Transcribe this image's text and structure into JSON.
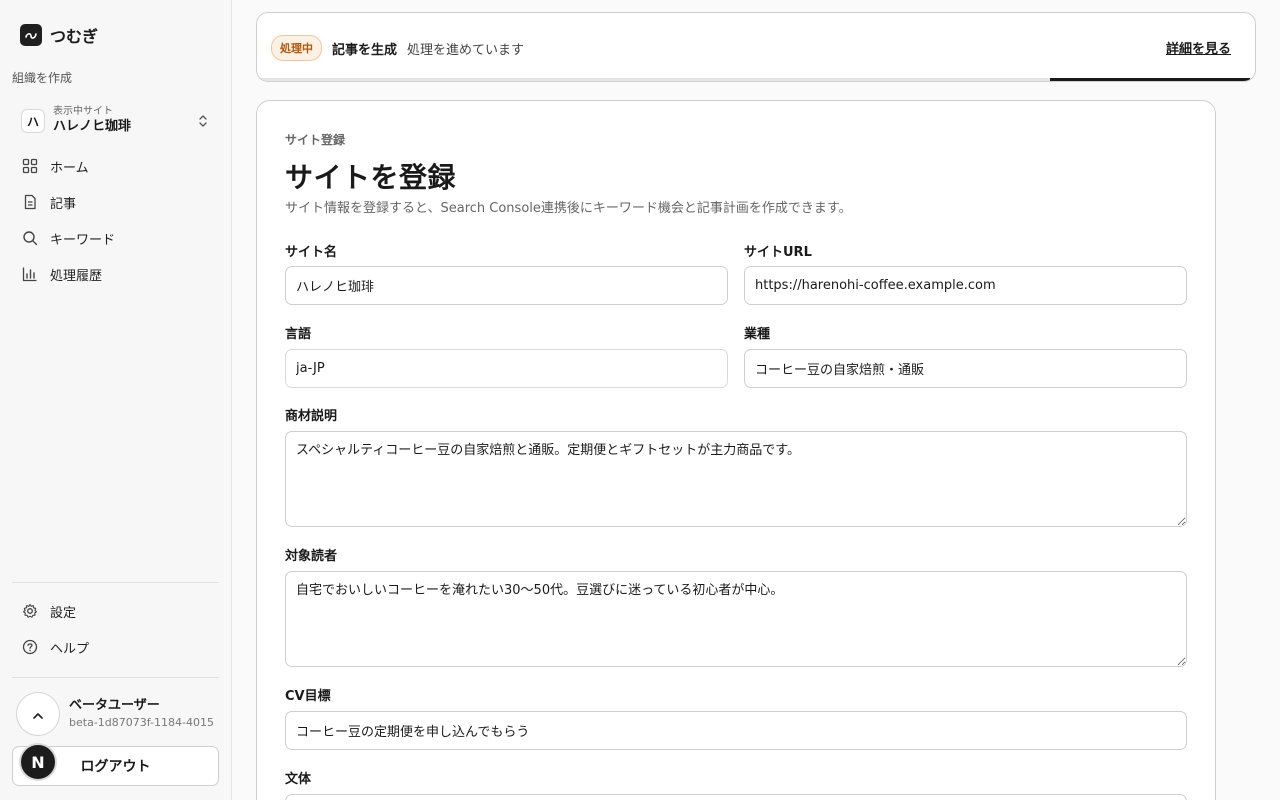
{
  "brand": {
    "name": "つむぎ"
  },
  "sidebar": {
    "org_create": "組織を作成",
    "site_switch": {
      "caption": "表示中サイト",
      "avatar_letter": "ハ",
      "name": "ハレノヒ珈琲"
    },
    "nav": [
      {
        "label": "ホーム",
        "icon": "home-grid-icon"
      },
      {
        "label": "記事",
        "icon": "document-icon"
      },
      {
        "label": "キーワード",
        "icon": "search-icon"
      },
      {
        "label": "処理履歴",
        "icon": "bar-chart-icon"
      }
    ],
    "bottom_nav": [
      {
        "label": "設定",
        "icon": "gear-icon"
      },
      {
        "label": "ヘルプ",
        "icon": "help-icon"
      }
    ],
    "user": {
      "name": "ベータユーザー",
      "id": "beta-1d87073f-1184-4015"
    },
    "logout_label": "ログアウト",
    "avatar_letter": "N"
  },
  "job": {
    "badge": "処理中",
    "title": "記事を生成",
    "status": "処理を進めています",
    "link": "詳細を見る",
    "progress_color": "#1a1a1a"
  },
  "form": {
    "breadcrumb": "サイト登録",
    "title": "サイトを登録",
    "description": "サイト情報を登録すると、Search Console連携後にキーワード機会と記事計画を作成できます。",
    "fields": {
      "site_name": {
        "label": "サイト名",
        "value": "ハレノヒ珈琲"
      },
      "site_url": {
        "label": "サイトURL",
        "value": "https://harenohi-coffee.example.com"
      },
      "language": {
        "label": "言語",
        "value": "ja-JP"
      },
      "industry": {
        "label": "業種",
        "value": "コーヒー豆の自家焙煎・通販"
      },
      "product": {
        "label": "商材説明",
        "value": "スペシャルティコーヒー豆の自家焙煎と通販。定期便とギフトセットが主力商品です。"
      },
      "audience": {
        "label": "対象読者",
        "value": "自宅でおいしいコーヒーを淹れたい30〜50代。豆選びに迷っている初心者が中心。"
      },
      "cv_goal": {
        "label": "CV目標",
        "value": "コーヒー豆の定期便を申し込んでもらう"
      },
      "tone": {
        "label": "文体",
        "value": ""
      }
    }
  },
  "colors": {
    "badge_text": "#b4560a",
    "badge_bg": "#fdf1e4",
    "accent": "#1a1a1a"
  }
}
